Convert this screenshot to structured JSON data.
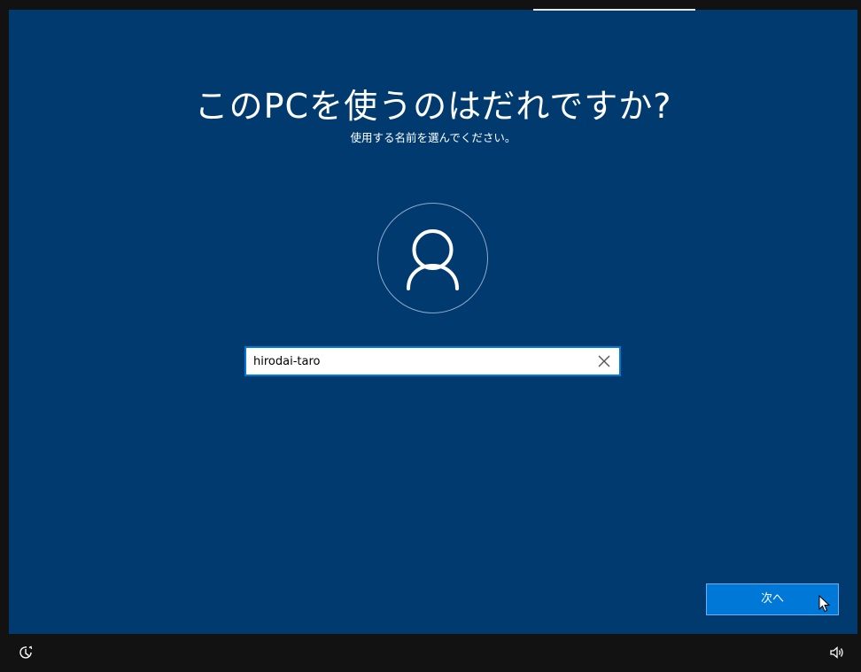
{
  "setup": {
    "title": "このPCを使うのはだれですか?",
    "subtitle": "使用する名前を選んでください。"
  },
  "avatar": {
    "icon": "person-icon"
  },
  "username_input": {
    "value": "hirodai-taro",
    "clear_icon": "close-icon"
  },
  "next_button": {
    "label": "次へ"
  },
  "bottom_bar": {
    "left_icon": "accessibility-icon",
    "right_icon": "volume-icon"
  },
  "colors": {
    "panel_background": "#003a6f",
    "accent": "#0078d7",
    "frame_background": "#121212"
  }
}
